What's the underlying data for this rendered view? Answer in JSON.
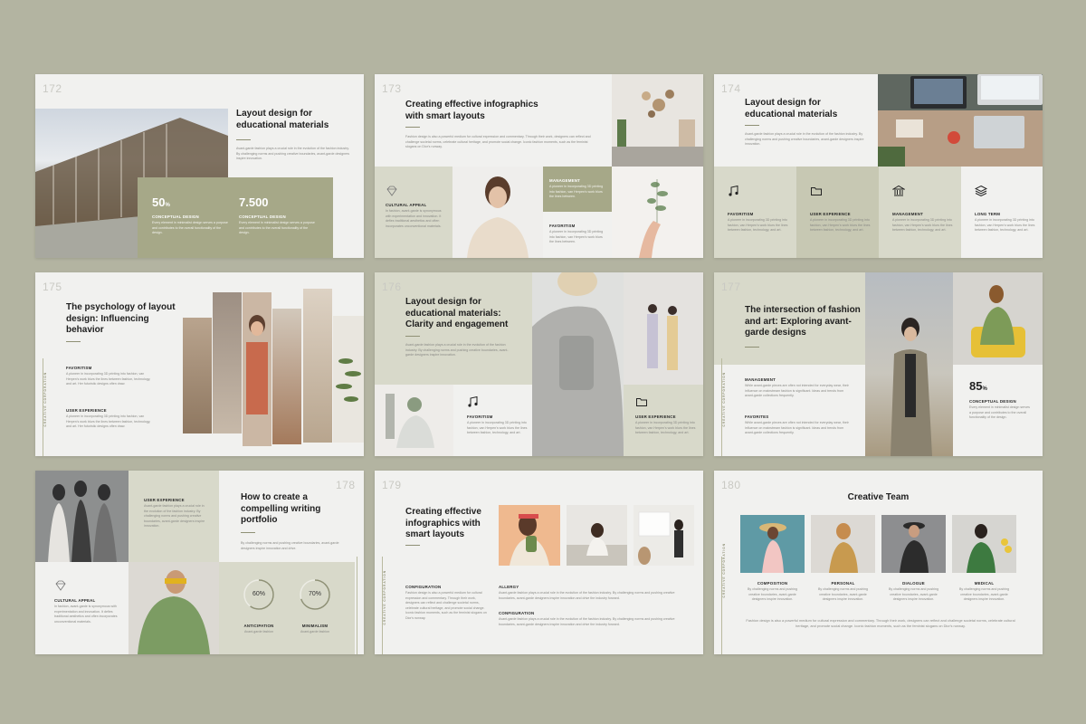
{
  "colors": {
    "background": "#b3b4a1",
    "slide": "#f1f1ef",
    "olive": "#a6a888",
    "sage": "#d8d9ca"
  },
  "vertical_label": "CREATIVE CORPORATION",
  "body_text": "Avant-garde fashion plays a crucial role in the evolution of the fashion industry. By challenging norms and pushing creative boundaries, avant-garde designers inspire innovation.",
  "s172": {
    "number": "172",
    "title": "Layout design for educational materials",
    "stat1": {
      "value": "50",
      "unit": "%",
      "label": "CONCEPTUAL DESIGN",
      "text": "Every element in minimalist design serves a purpose and contributes to the overall functionality of the design."
    },
    "stat2": {
      "value": "7.500",
      "label": "CONCEPTUAL DESIGN",
      "text": "Every element in minimalist design serves a purpose and contributes to the overall functionality of the design."
    }
  },
  "s173": {
    "number": "173",
    "title": "Creating effective infographics with smart layouts",
    "text": "Fashion design is also a powerful medium for cultural expression and commentary. Through their work, designers can reflect and challenge societal norms, celebrate cultural heritage, and promote social change. Iconic fashion moments, such as the feminist slogans on Dior's runway.",
    "col1": {
      "label": "CULTURAL APPEAL",
      "text": "In fashion, avant-garde is synonymous with experimentation and innovation. It defies traditional aesthetics and often incorporates unconventional materials."
    },
    "col2": {
      "label": "MANAGEMENT",
      "text": "A pioneer in incorporating 3D printing into fashion, van Herpen's work blurs the lines between."
    },
    "col3": {
      "label": "FAVORITISM",
      "text": "A pioneer in incorporating 3D printing into fashion, van Herpen's work blurs the lines between."
    }
  },
  "s174": {
    "number": "174",
    "title": "Layout design for educational materials",
    "features": [
      {
        "label": "FAVORITISM",
        "icon": "music-note-icon",
        "text": "A pioneer in incorporating 3D printing into fashion, van Herpen's work blurs the lines between fashion, technology, and art."
      },
      {
        "label": "USER EXPERIENCE",
        "icon": "folder-icon",
        "text": "A pioneer in incorporating 3D printing into fashion, van Herpen's work blurs the lines between fashion, technology, and art."
      },
      {
        "label": "MANAGEMENT",
        "icon": "bank-icon",
        "text": "A pioneer in incorporating 3D printing into fashion, van Herpen's work blurs the lines between fashion, technology, and art."
      },
      {
        "label": "LONG TERM",
        "icon": "layers-icon",
        "text": "A pioneer in incorporating 3D printing into fashion, van Herpen's work blurs the lines between fashion, technology, and art."
      }
    ]
  },
  "s175": {
    "number": "175",
    "title": "The psychology of layout design: Influencing behavior",
    "item1": {
      "label": "FAVORITISM",
      "text": "A pioneer in incorporating 3D printing into fashion, van Herpen's work blurs the lines between fashion, technology, and art. Her futuristic designs often draw."
    },
    "item2": {
      "label": "USER EXPERIENCE",
      "text": "A pioneer in incorporating 3D printing into fashion, van Herpen's work blurs the lines between fashion, technology, and art. Her futuristic designs often draw."
    }
  },
  "s176": {
    "number": "176",
    "title": "Layout design for educational materials: Clarity and engagement",
    "item1": {
      "label": "FAVORITISM",
      "icon": "music-note-icon",
      "text": "A pioneer in incorporating 3D printing into fashion, van Herpen's work blurs the lines between fashion, technology, and art."
    },
    "item2": {
      "label": "USER EXPERIENCE",
      "icon": "folder-icon",
      "text": "A pioneer in incorporating 3D printing into fashion, van Herpen's work blurs the lines between fashion, technology, and art."
    }
  },
  "s177": {
    "number": "177",
    "title": "The intersection of fashion and art: Exploring avant-garde designs",
    "item1": {
      "label": "MANAGEMENT",
      "text": "While avant-garde pieces are often not intended for everyday wear, their influence on mainstream fashion is significant. Ideas and trends from avant-garde collections frequently."
    },
    "item2": {
      "label": "FAVORITES",
      "text": "While avant-garde pieces are often not intended for everyday wear, their influence on mainstream fashion is significant. Ideas and trends from avant-garde collections frequently."
    },
    "stat": {
      "value": "85",
      "unit": "%",
      "label": "CONCEPTUAL DESIGN",
      "text": "Every element in minimalist design serves a purpose and contributes to the overall functionality of the design."
    }
  },
  "s178": {
    "number": "178",
    "title": "How to create a compelling writing portfolio",
    "text": "By challenging norms and pushing creative boundaries, avant-garde designers inspire innovation and drive.",
    "ux": {
      "label": "USER EXPERIENCE",
      "text": "Avant-garde fashion plays a crucial role in the evolution of the fashion industry. By challenging norms and pushing creative boundaries, avant-garde designers inspire innovation."
    },
    "appeal": {
      "label": "CULTURAL APPEAL",
      "text": "In fashion, avant-garde is synonymous with experimentation and innovation. It defies traditional aesthetics and often incorporates unconventional materials."
    },
    "ring1": {
      "percent": "60%",
      "value": 60,
      "label": "ANTICIPATION",
      "text": "Avant-garde fashion"
    },
    "ring2": {
      "percent": "70%",
      "value": 70,
      "label": "MINIMALISM",
      "text": "Avant-garde fashion"
    }
  },
  "s179": {
    "number": "179",
    "title": "Creating effective infographics with smart layouts",
    "config1": {
      "label": "CONFIGURATION",
      "text": "Fashion design is also a powerful medium for cultural expression and commentary. Through their work, designers can reflect and challenge societal norms, celebrate cultural heritage, and promote social change. Iconic fashion moments, such as the feminist slogans on Dior's runway."
    },
    "allergy": {
      "label": "ALLERGY",
      "text": "Avant-garde fashion plays a crucial role in the evolution of the fashion industry. By challenging norms and pushing creative boundaries, avant-garde designers inspire innovation and drive the industry forward."
    },
    "config2": {
      "label": "CONFIGURATION",
      "text": "Avant-garde fashion plays a crucial role in the evolution of the fashion industry. By challenging norms and pushing creative boundaries, avant-garde designers inspire innovation and drive the industry forward."
    }
  },
  "s180": {
    "number": "180",
    "title": "Creative Team",
    "members": [
      {
        "label": "COMPOSITION",
        "text": "By challenging norms and pushing creative boundaries, avant-garde designers inspire innovation."
      },
      {
        "label": "PERSONAL",
        "text": "By challenging norms and pushing creative boundaries, avant-garde designers inspire innovation."
      },
      {
        "label": "DIALOGUE",
        "text": "By challenging norms and pushing creative boundaries, avant-garde designers inspire innovation."
      },
      {
        "label": "MEDICAL",
        "text": "By challenging norms and pushing creative boundaries, avant-garde designers inspire innovation."
      }
    ],
    "footer": "Fashion design is also a powerful medium for cultural expression and commentary. Through their work, designers can reflect and challenge societal norms, celebrate cultural heritage, and promote social change. Iconic fashion moments, such as the feminist slogans on Dior's runway."
  }
}
